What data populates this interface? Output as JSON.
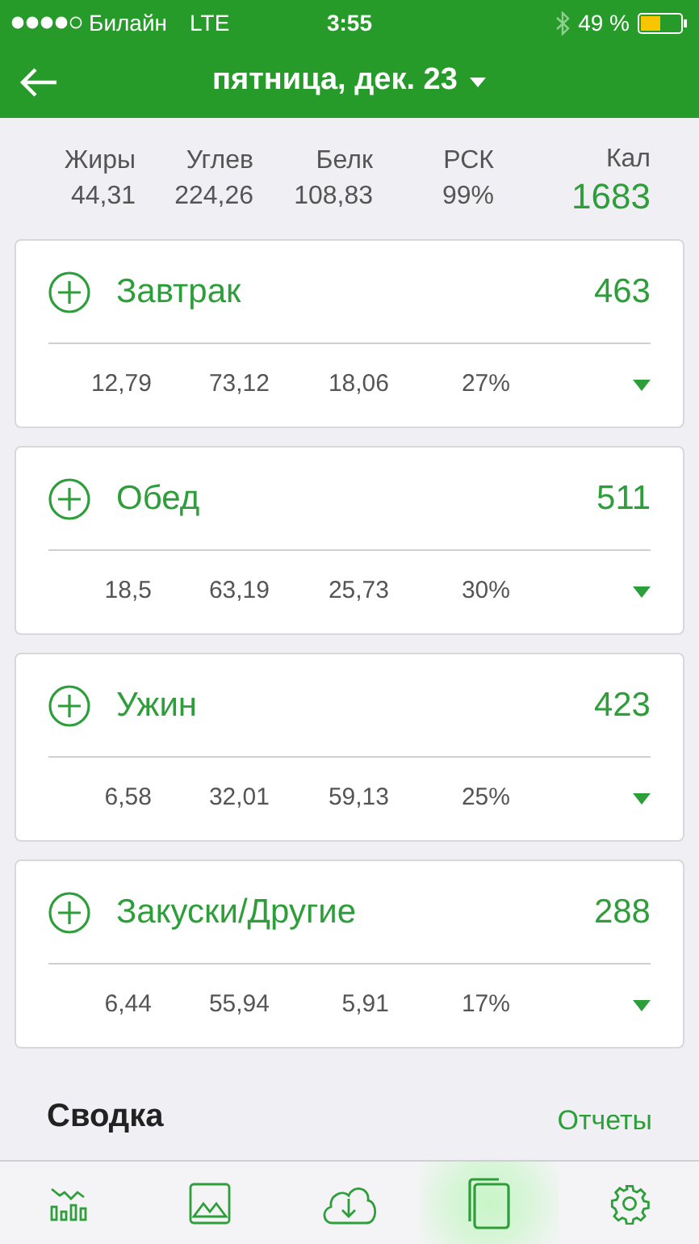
{
  "status_bar": {
    "carrier": "Билайн",
    "network": "LTE",
    "time": "3:55",
    "battery": "49 %"
  },
  "header": {
    "title": "пятница, дек. 23"
  },
  "summary": {
    "labels": [
      "Жиры",
      "Углев",
      "Белк",
      "РСК"
    ],
    "values": [
      "44,31",
      "224,26",
      "108,83",
      "99%"
    ],
    "calories_label": "Кал",
    "calories": "1683"
  },
  "meals": [
    {
      "name": "Завтрак",
      "calories": "463",
      "values": [
        "12,79",
        "73,12",
        "18,06",
        "27%"
      ]
    },
    {
      "name": "Обед",
      "calories": "511",
      "values": [
        "18,5",
        "63,19",
        "25,73",
        "30%"
      ]
    },
    {
      "name": "Ужин",
      "calories": "423",
      "values": [
        "6,58",
        "32,01",
        "59,13",
        "25%"
      ]
    },
    {
      "name": "Закуски/Другие",
      "calories": "288",
      "values": [
        "6,44",
        "55,94",
        "5,91",
        "17%"
      ]
    }
  ],
  "summary_section": {
    "title": "Сводка",
    "link": "Отчеты"
  },
  "tab_bar": [
    {
      "kind": "chart",
      "selected": false
    },
    {
      "kind": "image",
      "selected": false
    },
    {
      "kind": "download",
      "selected": false
    },
    {
      "kind": "pages",
      "selected": true
    },
    {
      "kind": "settings",
      "selected": false
    }
  ]
}
